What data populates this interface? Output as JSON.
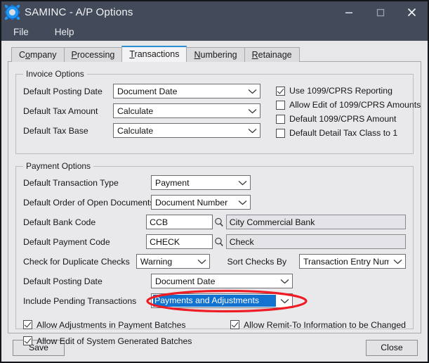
{
  "window": {
    "title": "SAMINC - A/P Options",
    "icon": "gear-icon",
    "minimize": "–",
    "maximize": "□",
    "close": "✕"
  },
  "menubar": {
    "items": [
      {
        "label": "File"
      },
      {
        "label": "Help"
      }
    ]
  },
  "tabs": [
    {
      "label": "Company",
      "accel": "o",
      "active": false
    },
    {
      "label": "Processing",
      "accel": "P",
      "active": false
    },
    {
      "label": "Transactions",
      "accel": "T",
      "active": true
    },
    {
      "label": "Numbering",
      "accel": "N",
      "active": false
    },
    {
      "label": "Retainage",
      "accel": "R",
      "active": false
    }
  ],
  "invoice_options": {
    "title": "Invoice Options",
    "fields": [
      {
        "label": "Default Posting Date",
        "value": "Document Date"
      },
      {
        "label": "Default Tax Amount",
        "value": "Calculate"
      },
      {
        "label": "Default Tax Base",
        "value": "Calculate"
      }
    ],
    "checkboxes": [
      {
        "label": "Use 1099/CPRS Reporting",
        "checked": true
      },
      {
        "label": "Allow Edit of 1099/CPRS Amounts",
        "checked": false
      },
      {
        "label": "Default 1099/CPRS Amount",
        "checked": false
      },
      {
        "label": "Default Detail Tax Class to 1",
        "checked": false
      }
    ]
  },
  "payment_options": {
    "title": "Payment Options",
    "transaction_type": {
      "label": "Default Transaction Type",
      "value": "Payment"
    },
    "order_open_docs": {
      "label": "Default Order of Open Documents",
      "value": "Document Number"
    },
    "bank_code": {
      "label": "Default Bank Code",
      "value": "CCB",
      "description": "City Commercial Bank",
      "finder": "magnifier-icon"
    },
    "payment_code": {
      "label": "Default Payment Code",
      "value": "CHECK",
      "description": "Check",
      "finder": "magnifier-icon"
    },
    "duplicate_checks": {
      "label": "Check for Duplicate Checks",
      "value": "Warning"
    },
    "sort_checks_by": {
      "label": "Sort Checks By",
      "value": "Transaction Entry Number"
    },
    "posting_date": {
      "label": "Default Posting Date",
      "value": "Document Date"
    },
    "pending_transactions": {
      "label": "Include Pending Transactions",
      "value": "Payments and Adjustments",
      "selected": true,
      "highlight_color": "#1172d0",
      "annotation_color": "#ee1c24"
    },
    "checkboxes": [
      {
        "label": "Allow Adjustments in Payment Batches",
        "checked": true
      },
      {
        "label": "Allow Remit-To Information to be Changed",
        "checked": true
      },
      {
        "label": "Allow Edit of System Generated Batches",
        "checked": true
      }
    ]
  },
  "buttons": {
    "save": "Save",
    "close": "Close"
  },
  "colors": {
    "titlebar": "#434a5a",
    "client": "#e7e7ea",
    "accent": "#2c8fd6",
    "selection": "#1172d0",
    "annotation": "#ee1c24"
  }
}
